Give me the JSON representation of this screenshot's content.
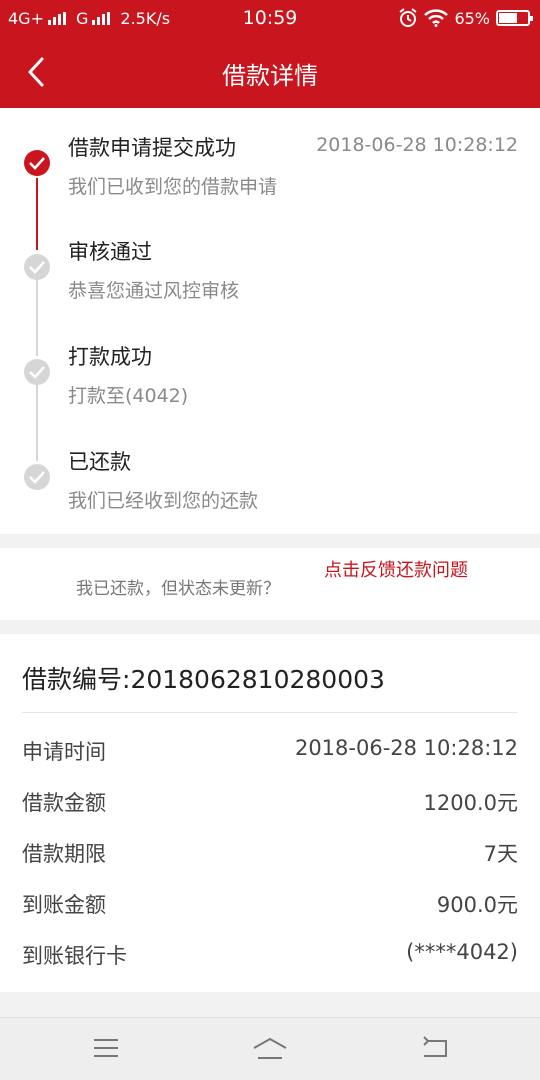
{
  "status_bar": {
    "network": "4G+",
    "network2": "G",
    "speed": "2.5K/s",
    "time": "10:59",
    "battery": "65%",
    "icons": [
      "signal-icon",
      "alarm-icon",
      "wifi-icon",
      "battery-icon"
    ]
  },
  "header": {
    "title": "借款详情",
    "back_icon": "back-chevron-icon"
  },
  "timeline": [
    {
      "title": "借款申请提交成功",
      "desc": "我们已收到您的借款申请",
      "time": "2018-06-28 10:28:12",
      "active": true
    },
    {
      "title": "审核通过",
      "desc": "恭喜您通过风控审核",
      "time": "",
      "active": false
    },
    {
      "title": "打款成功",
      "desc": "打款至(4042)",
      "time": "",
      "active": false
    },
    {
      "title": "已还款",
      "desc": "我们已经收到您的还款",
      "time": "",
      "active": false
    }
  ],
  "feedback": {
    "question": "我已还款，但状态未更新？",
    "link": "点击反馈还款问题"
  },
  "details": {
    "loan_no_label": "借款编号:",
    "loan_no": "2018062810280003",
    "rows": [
      {
        "label": "申请时间",
        "value": "2018-06-28 10:28:12"
      },
      {
        "label": "借款金额",
        "value": "1200.0元"
      },
      {
        "label": "借款期限",
        "value": "7天"
      },
      {
        "label": "到账金额",
        "value": "900.0元"
      },
      {
        "label": "到账银行卡",
        "value": "(****4042)"
      }
    ]
  },
  "nav_keys": [
    "menu-icon",
    "home-icon",
    "back-icon"
  ],
  "colors": {
    "brand": "#c9151e",
    "inactive": "#d6d6d6"
  }
}
